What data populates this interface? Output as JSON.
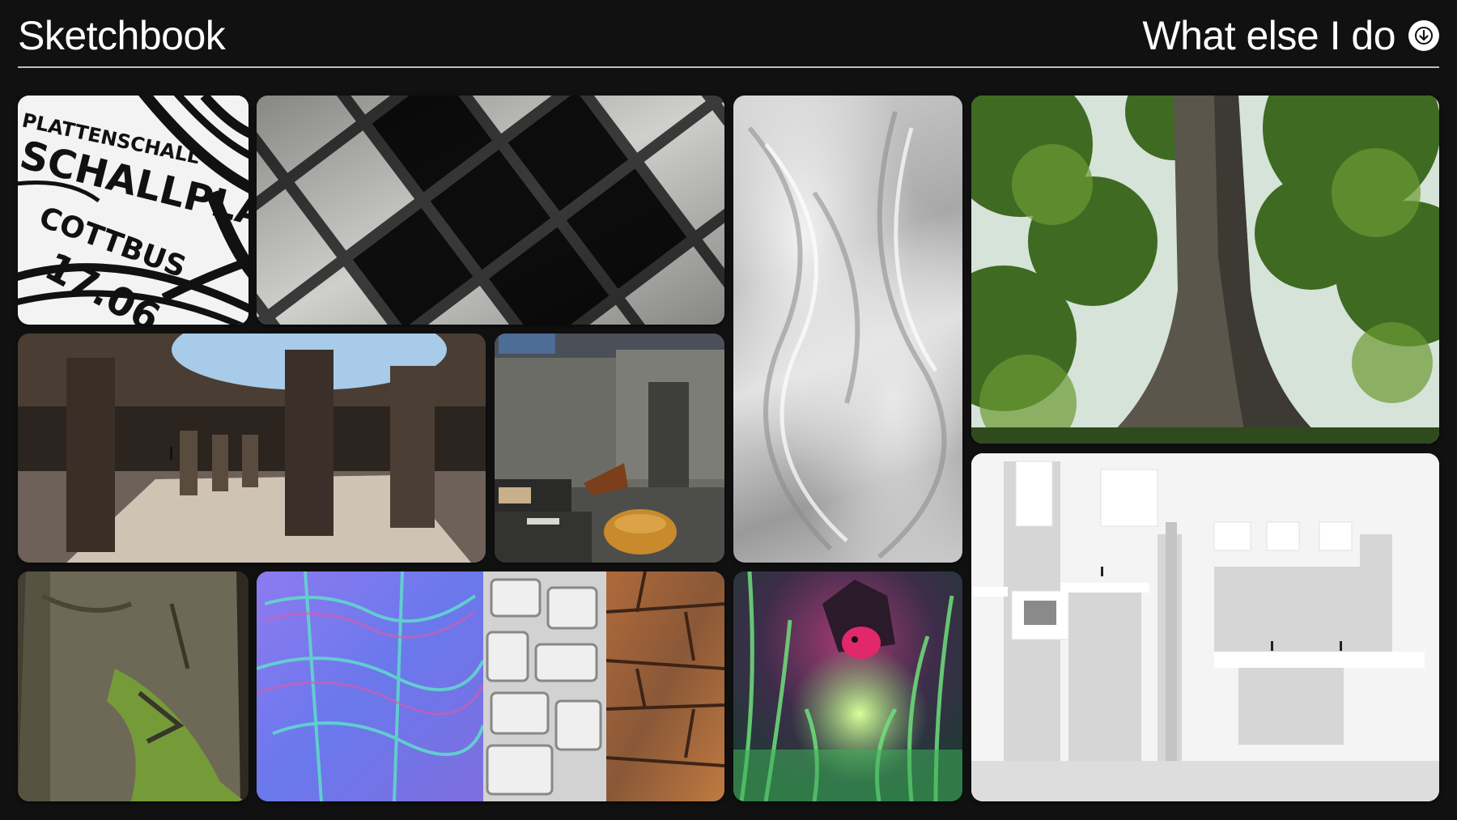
{
  "header": {
    "title": "Sketchbook",
    "nav_label": "What else I do",
    "nav_icon": "arrow-down-circle-icon"
  },
  "poster": {
    "lines": [
      "PLATTENSCHALL",
      "SCHALLPLATT",
      "COTTBUS",
      "17.06"
    ]
  },
  "colors": {
    "background": "#111111",
    "text": "#ffffff",
    "divider": "#bdbdbd"
  }
}
